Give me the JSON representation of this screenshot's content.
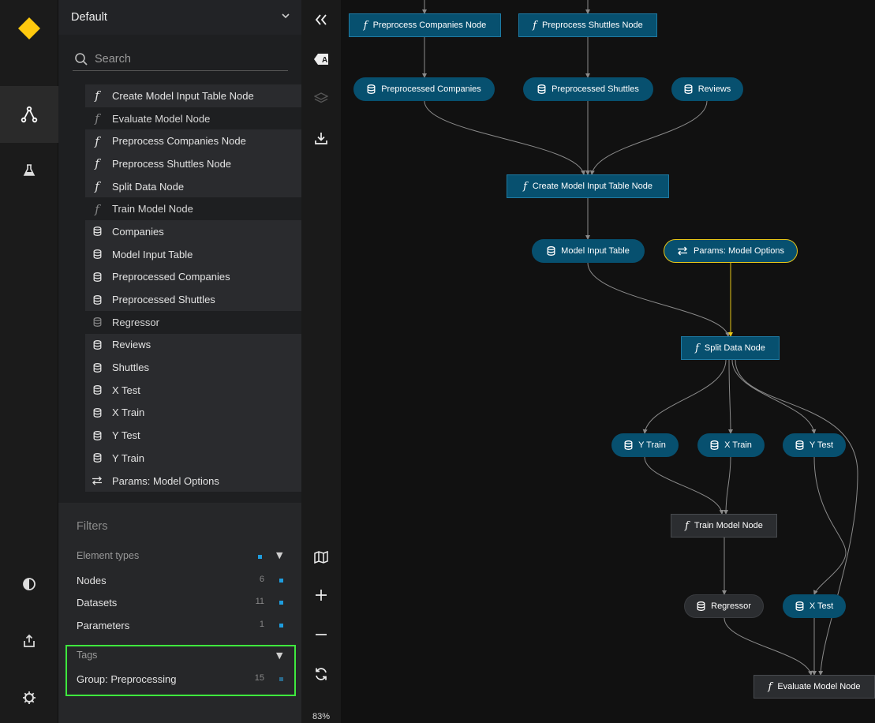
{
  "rail": {
    "items": [
      {
        "name": "kedro-logo",
        "icon": "diamond-logo"
      },
      {
        "name": "flowchart-view",
        "icon": "flowchart-icon",
        "active": true
      },
      {
        "name": "experiment-tracking",
        "icon": "flask-icon"
      },
      {
        "name": "theme-toggle",
        "icon": "half-circle-icon"
      },
      {
        "name": "export",
        "icon": "export-icon"
      },
      {
        "name": "settings",
        "icon": "gear-icon"
      }
    ],
    "logo_color": "#ffc90e"
  },
  "sidebar": {
    "pipeline": "Default",
    "search_placeholder": "Search",
    "tree": [
      {
        "label": "Create Model Input Table Node",
        "type": "task",
        "on": true
      },
      {
        "label": "Evaluate Model Node",
        "type": "task",
        "on": false
      },
      {
        "label": "Preprocess Companies Node",
        "type": "task",
        "on": true
      },
      {
        "label": "Preprocess Shuttles Node",
        "type": "task",
        "on": true
      },
      {
        "label": "Split Data Node",
        "type": "task",
        "on": true
      },
      {
        "label": "Train Model Node",
        "type": "task",
        "on": false
      },
      {
        "label": "Companies",
        "type": "data",
        "on": true
      },
      {
        "label": "Model Input Table",
        "type": "data",
        "on": true
      },
      {
        "label": "Preprocessed Companies",
        "type": "data",
        "on": true
      },
      {
        "label": "Preprocessed Shuttles",
        "type": "data",
        "on": true
      },
      {
        "label": "Regressor",
        "type": "data",
        "on": false
      },
      {
        "label": "Reviews",
        "type": "data",
        "on": true
      },
      {
        "label": "Shuttles",
        "type": "data",
        "on": true
      },
      {
        "label": "X Test",
        "type": "data",
        "on": true
      },
      {
        "label": "X Train",
        "type": "data",
        "on": true
      },
      {
        "label": "Y Test",
        "type": "data",
        "on": true
      },
      {
        "label": "Y Train",
        "type": "data",
        "on": true
      },
      {
        "label": "Params: Model Options",
        "type": "param",
        "on": true
      }
    ],
    "filters": {
      "title": "Filters",
      "element_types_label": "Element types",
      "element_types": [
        {
          "label": "Nodes",
          "count": "6"
        },
        {
          "label": "Datasets",
          "count": "11"
        },
        {
          "label": "Parameters",
          "count": "1"
        }
      ],
      "tags_label": "Tags",
      "tags": [
        {
          "label": "Group: Preprocessing",
          "count": "15"
        }
      ]
    }
  },
  "tools": {
    "items": [
      "collapse-sidebar-icon",
      "label-toggle-icon",
      "layers-icon",
      "download-icon",
      "minimap-icon",
      "zoom-in-icon",
      "zoom-out-icon",
      "reset-zoom-icon"
    ],
    "zoom": "83%"
  },
  "graph": {
    "nodes": [
      {
        "id": "pc",
        "label": "Preprocess Companies Node",
        "kind": "task"
      },
      {
        "id": "ps",
        "label": "Preprocess Shuttles Node",
        "kind": "task"
      },
      {
        "id": "pco",
        "label": "Preprocessed Companies",
        "kind": "data"
      },
      {
        "id": "psh",
        "label": "Preprocessed Shuttles",
        "kind": "data"
      },
      {
        "id": "rev",
        "label": "Reviews",
        "kind": "data"
      },
      {
        "id": "cmit",
        "label": "Create Model Input Table Node",
        "kind": "task"
      },
      {
        "id": "mit",
        "label": "Model Input Table",
        "kind": "data"
      },
      {
        "id": "pmo",
        "label": "Params: Model Options",
        "kind": "param"
      },
      {
        "id": "sd",
        "label": "Split Data Node",
        "kind": "task"
      },
      {
        "id": "ytr",
        "label": "Y Train",
        "kind": "data"
      },
      {
        "id": "xtr",
        "label": "X Train",
        "kind": "data"
      },
      {
        "id": "yte",
        "label": "Y Test",
        "kind": "data"
      },
      {
        "id": "tm",
        "label": "Train Model Node",
        "kind": "task",
        "faded": true
      },
      {
        "id": "reg",
        "label": "Regressor",
        "kind": "data",
        "faded": true
      },
      {
        "id": "xte",
        "label": "X Test",
        "kind": "data"
      },
      {
        "id": "em",
        "label": "Evaluate Model Node",
        "kind": "task",
        "faded": true
      }
    ],
    "colors": {
      "node": "#07506f",
      "edge": "#8a8a8a",
      "param_edge": "#e6c619",
      "tag_highlight": "#3ee83e"
    }
  }
}
